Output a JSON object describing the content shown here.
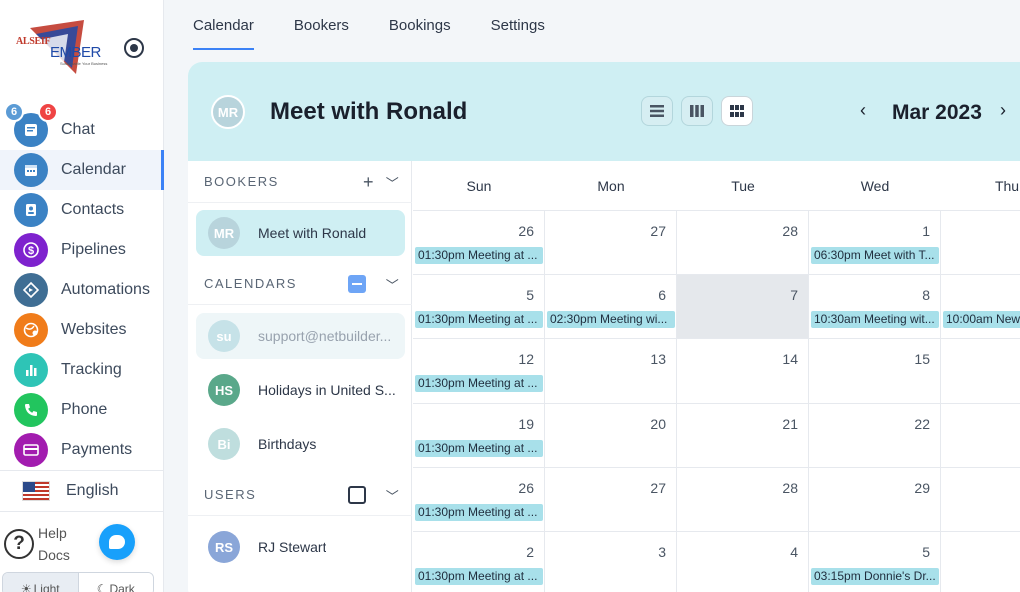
{
  "sidebar": {
    "logo": {
      "top_text": "ALSEIF",
      "main_text": "EMBER",
      "sub_text": "Sustainable Your Business"
    },
    "nav": [
      {
        "label": "Chat",
        "icon": "chat-icon",
        "color": "#3b82c4"
      },
      {
        "label": "Calendar",
        "icon": "calendar-icon",
        "color": "#3b82c4",
        "active": true
      },
      {
        "label": "Contacts",
        "icon": "contacts-icon",
        "color": "#3b82c4"
      },
      {
        "label": "Pipelines",
        "icon": "dollar-icon",
        "color": "#7e22ce"
      },
      {
        "label": "Automations",
        "icon": "automation-icon",
        "color": "#3f6e94"
      },
      {
        "label": "Websites",
        "icon": "globe-icon",
        "color": "#f07c1a"
      },
      {
        "label": "Tracking",
        "icon": "bar-chart-icon",
        "color": "#2ec4b6"
      },
      {
        "label": "Phone",
        "icon": "phone-icon",
        "color": "#22c55e"
      },
      {
        "label": "Payments",
        "icon": "card-icon",
        "color": "#a21caf"
      }
    ],
    "badges": {
      "first": "6",
      "second": "6"
    },
    "language": "English",
    "help": {
      "line1": "Help",
      "line2": "Docs"
    },
    "theme": {
      "light": "Light",
      "dark": "Dark"
    }
  },
  "tabs": [
    "Calendar",
    "Bookers",
    "Bookings",
    "Settings"
  ],
  "header": {
    "avatar": "MR",
    "title": "Meet with Ronald",
    "month": "Mar 2023"
  },
  "bookers": {
    "title": "BOOKERS",
    "items": [
      {
        "initials": "MR",
        "name": "Meet with Ronald",
        "color": "#b8d4dc"
      }
    ]
  },
  "calendars": {
    "title": "CALENDARS",
    "items": [
      {
        "initials": "su",
        "name": "support@netbuilder...",
        "color": "#c6e2e8"
      },
      {
        "initials": "HS",
        "name": "Holidays in United S...",
        "color": "#5aa88a"
      },
      {
        "initials": "Bi",
        "name": "Birthdays",
        "color": "#bfdede"
      }
    ]
  },
  "users": {
    "title": "USERS",
    "items": [
      {
        "initials": "RS",
        "name": "RJ Stewart",
        "color": "#8aa6d8"
      }
    ]
  },
  "calendar": {
    "days": [
      "Sun",
      "Mon",
      "Tue",
      "Wed",
      "Thu"
    ],
    "weeks": [
      [
        {
          "day": "26",
          "event": "01:30pm Meeting at ..."
        },
        {
          "day": "27"
        },
        {
          "day": "28"
        },
        {
          "day": "1",
          "event": "06:30pm Meet with T..."
        },
        {
          "day": ""
        }
      ],
      [
        {
          "day": "5",
          "event": "01:30pm Meeting at ..."
        },
        {
          "day": "6",
          "event": "02:30pm Meeting wi..."
        },
        {
          "day": "7",
          "today": true
        },
        {
          "day": "8",
          "event": "10:30am Meeting wit..."
        },
        {
          "day": "",
          "event": "10:00am New"
        }
      ],
      [
        {
          "day": "12",
          "event": "01:30pm Meeting at ..."
        },
        {
          "day": "13"
        },
        {
          "day": "14"
        },
        {
          "day": "15"
        },
        {
          "day": ""
        }
      ],
      [
        {
          "day": "19",
          "event": "01:30pm Meeting at ..."
        },
        {
          "day": "20"
        },
        {
          "day": "21"
        },
        {
          "day": "22"
        },
        {
          "day": ""
        }
      ],
      [
        {
          "day": "26",
          "event": "01:30pm Meeting at ..."
        },
        {
          "day": "27"
        },
        {
          "day": "28"
        },
        {
          "day": "29"
        },
        {
          "day": ""
        }
      ],
      [
        {
          "day": "2",
          "event": "01:30pm Meeting at ..."
        },
        {
          "day": "3"
        },
        {
          "day": "4"
        },
        {
          "day": "5",
          "event": "03:15pm Donnie's Dr..."
        },
        {
          "day": ""
        }
      ]
    ]
  }
}
